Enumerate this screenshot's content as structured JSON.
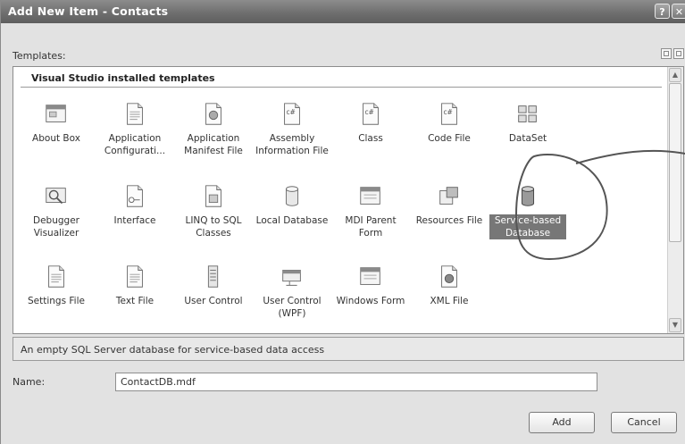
{
  "window": {
    "title": "Add New Item - Contacts",
    "help_glyph": "?",
    "close_glyph": "✕"
  },
  "templates_label": "Templates:",
  "group_header": "Visual Studio installed templates",
  "templates": [
    {
      "label": "About Box",
      "icon": "about-box-icon"
    },
    {
      "label": "Application Configurati...",
      "icon": "app-config-icon"
    },
    {
      "label": "Application Manifest File",
      "icon": "manifest-icon"
    },
    {
      "label": "Assembly Information File",
      "icon": "assembly-info-icon"
    },
    {
      "label": "Class",
      "icon": "class-icon"
    },
    {
      "label": "Code File",
      "icon": "code-file-icon"
    },
    {
      "label": "DataSet",
      "icon": "dataset-icon"
    },
    {
      "label": "Debugger Visualizer",
      "icon": "debugger-visualizer-icon"
    },
    {
      "label": "Interface",
      "icon": "interface-icon"
    },
    {
      "label": "LINQ to SQL Classes",
      "icon": "linq-icon"
    },
    {
      "label": "Local Database",
      "icon": "local-database-icon"
    },
    {
      "label": "MDI Parent Form",
      "icon": "mdi-form-icon"
    },
    {
      "label": "Resources File",
      "icon": "resources-icon"
    },
    {
      "label": "Service-based Database",
      "icon": "service-database-icon",
      "selected": true
    },
    {
      "label": "Settings File",
      "icon": "settings-file-icon"
    },
    {
      "label": "Text File",
      "icon": "text-file-icon"
    },
    {
      "label": "User Control",
      "icon": "user-control-icon"
    },
    {
      "label": "User Control (WPF)",
      "icon": "wpf-user-control-icon"
    },
    {
      "label": "Windows Form",
      "icon": "windows-form-icon"
    },
    {
      "label": "XML File",
      "icon": "xml-file-icon"
    }
  ],
  "description": "An empty SQL Server database for service-based data access",
  "name_label": "Name:",
  "name_value": "ContactDB.mdf",
  "buttons": {
    "add": "Add",
    "cancel": "Cancel"
  },
  "colors": {
    "title_bar": "#6f6f6f",
    "dialog_bg": "#e2e2e2",
    "selection": "#777777"
  }
}
